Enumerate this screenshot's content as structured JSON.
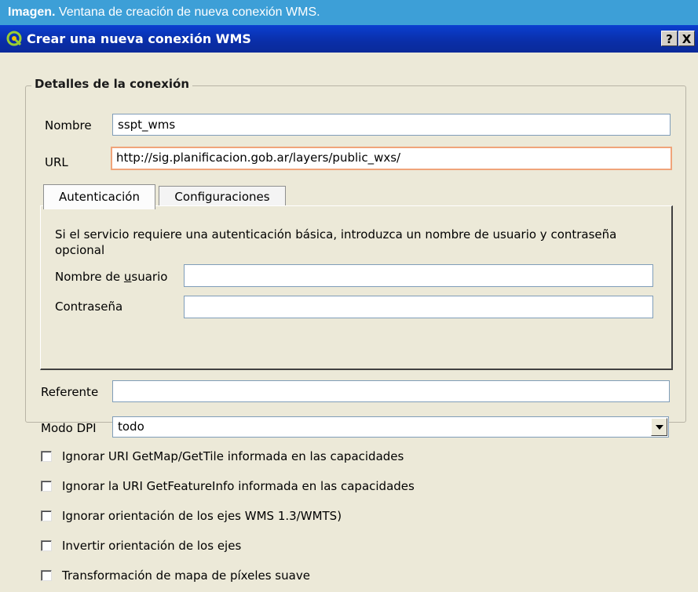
{
  "caption": {
    "prefix": "Imagen.",
    "text": " Ventana de creación de nueva conexión WMS."
  },
  "window": {
    "title": "Crear una nueva conexión WMS",
    "help_label": "?",
    "close_label": "X"
  },
  "group": {
    "title": "Detalles de la conexión"
  },
  "form": {
    "name_label": "Nombre",
    "name_value": "sspt_wms",
    "url_label": "URL",
    "url_value": "http://sig.planificacion.gob.ar/layers/public_wxs/"
  },
  "tabs": [
    {
      "label": "Autenticación",
      "active": true
    },
    {
      "label": "Configuraciones",
      "active": false
    }
  ],
  "auth": {
    "description": "Si el servicio requiere una autenticación básica, introduzca un nombre de usuario y contraseña opcional",
    "username_label_pre": "Nombre de ",
    "username_label_mnemonic": "u",
    "username_label_post": "suario",
    "username_value": "",
    "password_label": "Contraseña",
    "password_value": ""
  },
  "referer": {
    "label": "Referente",
    "value": ""
  },
  "dpi": {
    "label": "Modo DPI",
    "selected": "todo"
  },
  "options": [
    {
      "label": "Ignorar URI GetMap/GetTile informada en las capacidades",
      "checked": false
    },
    {
      "label": "Ignorar la URI GetFeatureInfo informada en las capacidades",
      "checked": false
    },
    {
      "label": "Ignorar orientación de los ejes WMS 1.3/WMTS)",
      "checked": false
    },
    {
      "label": "Invertir orientación de los ejes",
      "checked": false
    },
    {
      "label": "Transformación de mapa de píxeles suave",
      "checked": false
    }
  ],
  "icons": {
    "app": "qgis-icon",
    "dropdown": "chevron-down-icon"
  },
  "colors": {
    "caption_bg": "#3d9fd7",
    "titlebar_bg": "#0a2ea8",
    "dialog_bg": "#ece9d8",
    "focus_border": "#f0a47a"
  }
}
